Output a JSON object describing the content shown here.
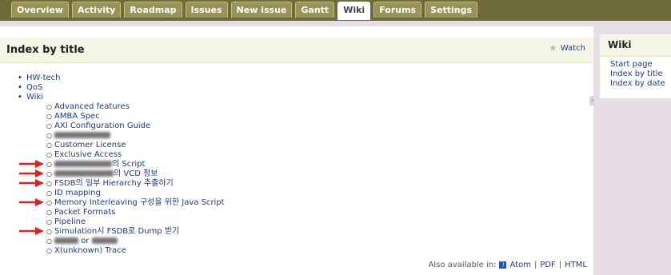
{
  "tabs": [
    {
      "label": "Overview"
    },
    {
      "label": "Activity"
    },
    {
      "label": "Roadmap"
    },
    {
      "label": "Issues"
    },
    {
      "label": "New issue"
    },
    {
      "label": "Gantt"
    },
    {
      "label": "Wiki"
    },
    {
      "label": "Forums"
    },
    {
      "label": "Settings"
    }
  ],
  "main": {
    "title": "Index by title",
    "watch_label": "Watch"
  },
  "index": {
    "top": [
      "HW-tech",
      "QoS",
      "Wiki"
    ],
    "wiki_children": [
      {
        "label": "Advanced features"
      },
      {
        "label": "AMBA Spec"
      },
      {
        "label": "AXI Configuration Guide"
      },
      {
        "label": ""
      },
      {
        "label": "Customer License"
      },
      {
        "label": "Exclusive Access"
      },
      {
        "label": "의 Script"
      },
      {
        "label": "의 VCD 정보"
      },
      {
        "label": "FSDB의 일부 Hierarchy 추출하기"
      },
      {
        "label": "ID mapping"
      },
      {
        "label": "Memory Interleaving 구성을 위한 Java Script"
      },
      {
        "label": "Packet Formats"
      },
      {
        "label": "Pipeline"
      },
      {
        "label": "Simulation시 FSDB로 Dump 받기"
      },
      {
        "label": "or"
      },
      {
        "label": "X(unknown) Trace"
      }
    ]
  },
  "footer": {
    "also_available": "Also available in:",
    "atom": "Atom",
    "pdf": "PDF",
    "html": "HTML",
    "sep": "|"
  },
  "sidebar": {
    "title": "Wiki",
    "links": [
      "Start page",
      "Index by title",
      "Index by date"
    ]
  },
  "colors": {
    "tabbar": "#6e6a39",
    "tab": "#9a9357",
    "link": "#1a3b8c",
    "arrow": "#e02020",
    "header_bg": "#f6f6e6"
  }
}
